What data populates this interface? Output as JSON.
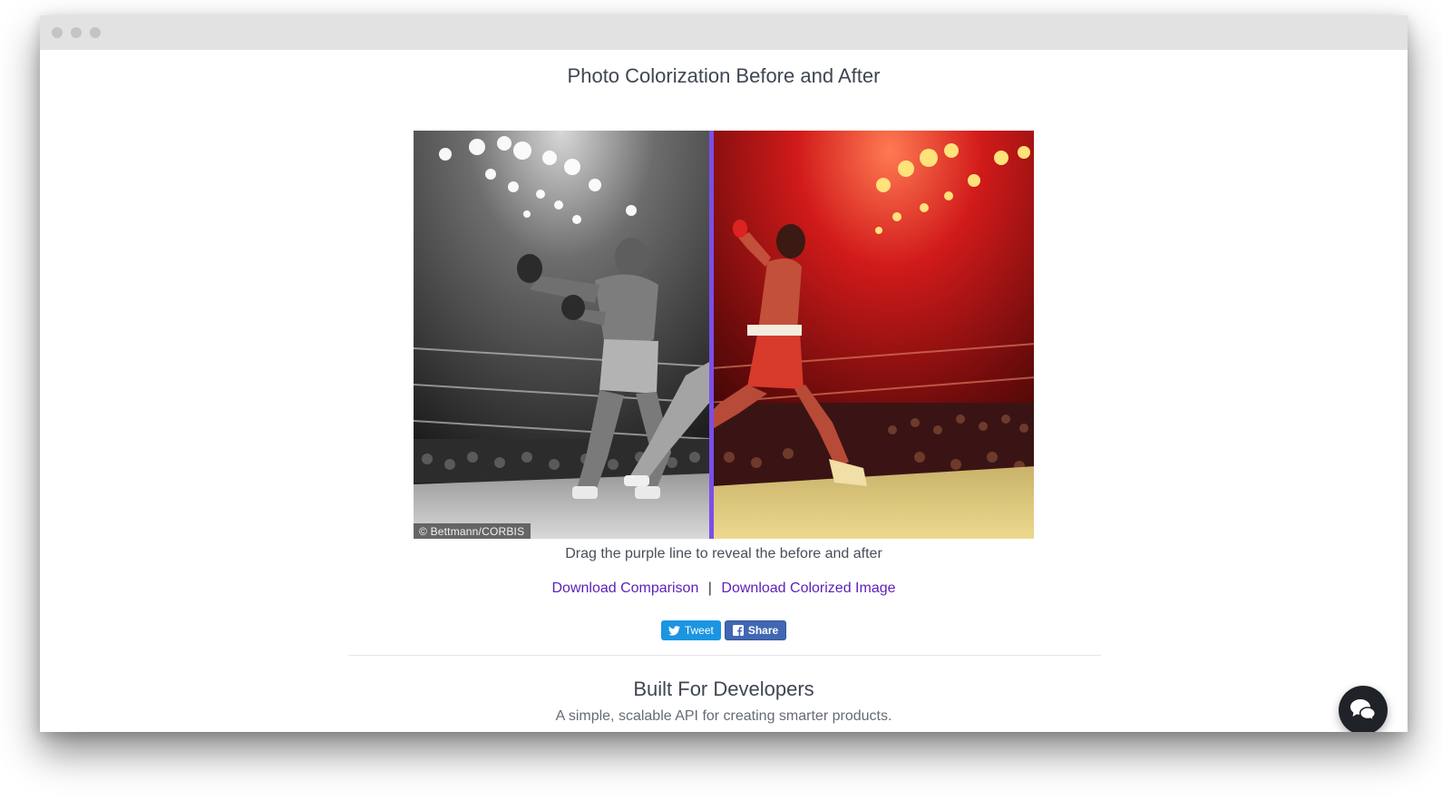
{
  "page": {
    "title": "Photo Colorization Before and After"
  },
  "comparison": {
    "credit": "© Bettmann/CORBIS",
    "divider_color": "#7b4fe6",
    "divider_position": 0.48,
    "caption": "Drag the purple line to reveal the before and after"
  },
  "downloads": {
    "comparison_label": "Download Comparison",
    "separator": "|",
    "colorized_label": "Download Colorized Image"
  },
  "social": {
    "tweet_label": "Tweet",
    "share_label": "Share"
  },
  "developers": {
    "title": "Built For Developers",
    "subtitle": "A simple, scalable API for creating smarter products."
  },
  "icons": {
    "twitter": "twitter-bird-icon",
    "facebook": "facebook-icon",
    "chat": "chat-bubbles-icon"
  },
  "colors": {
    "link": "#5b1fb8",
    "twitter": "#1b95e0",
    "facebook": "#4267b2",
    "chat_button": "#1f2226"
  }
}
